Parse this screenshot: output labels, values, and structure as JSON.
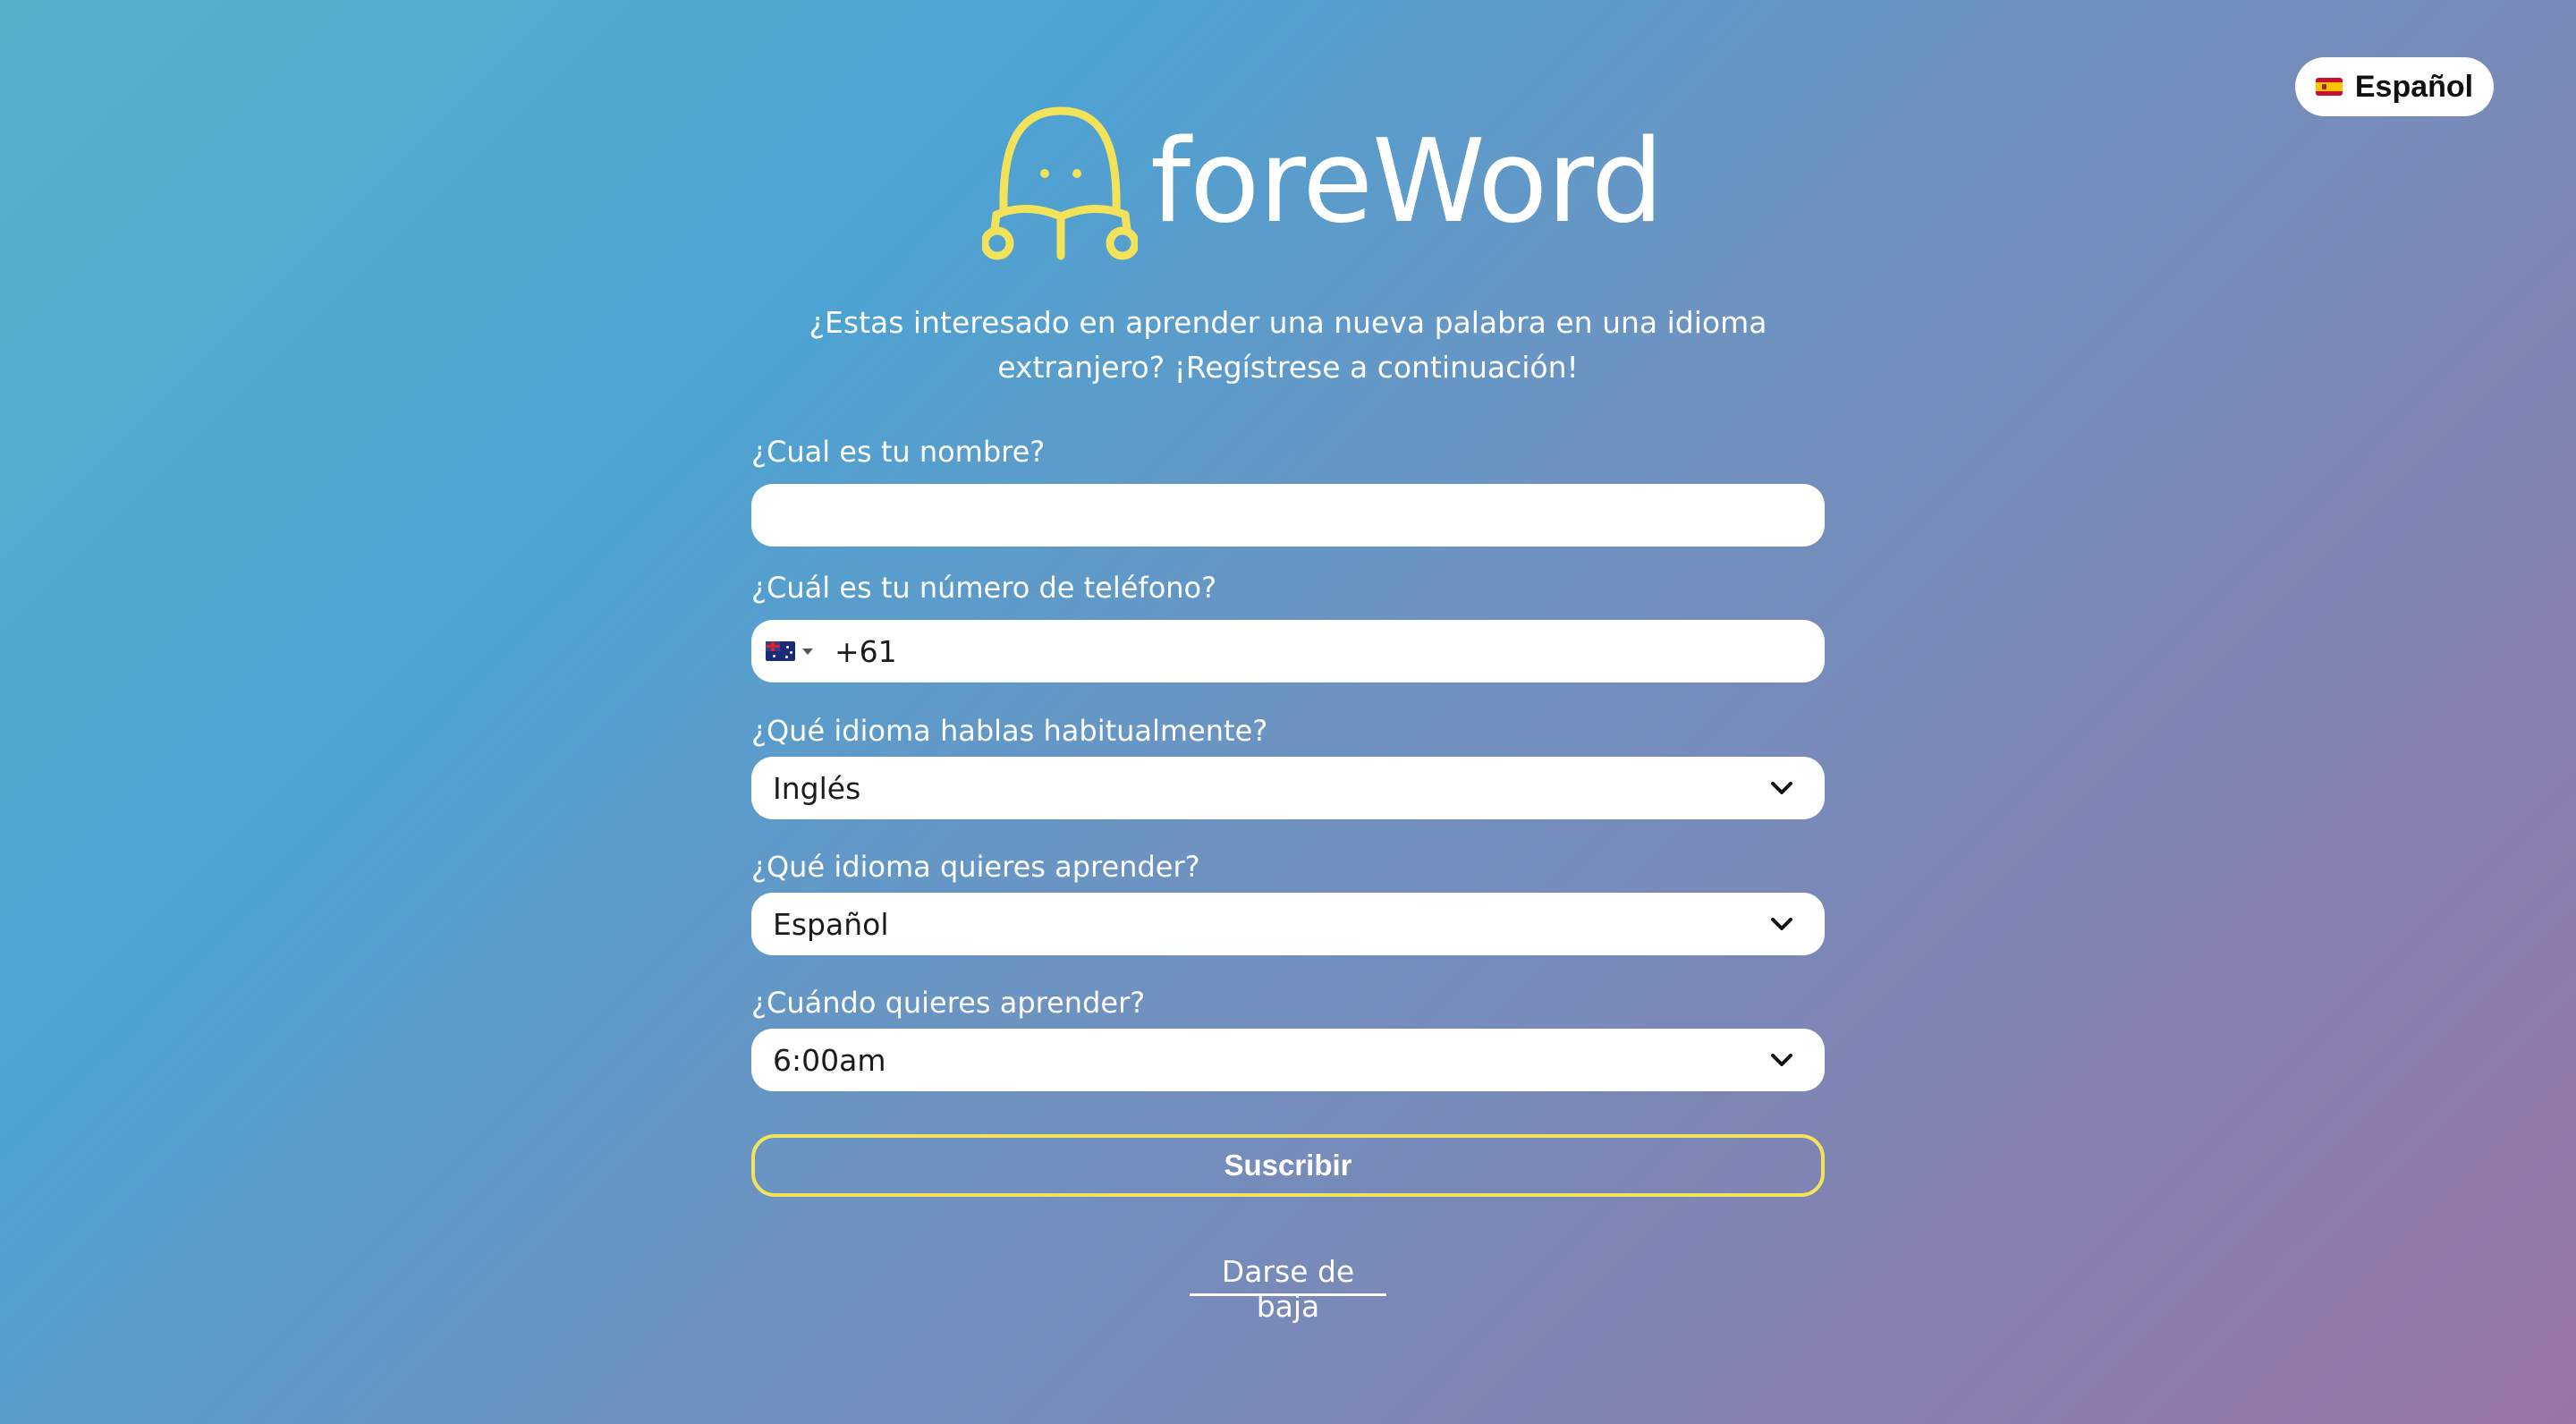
{
  "language_toggle": {
    "label": "Español",
    "flag_icon": "spain-flag-icon"
  },
  "header": {
    "logo_icon": "reading-person-logo-icon",
    "brand_name": "foreWord",
    "intro_line1": "¿Estas interesado en aprender una nueva palabra en una idioma",
    "intro_line2": "extranjero? ¡Regístrese a continuación!"
  },
  "form": {
    "name": {
      "label": "¿Cual es tu nombre?",
      "value": ""
    },
    "phone": {
      "label": "¿Cuál es tu número de teléfono?",
      "country_flag_icon": "australia-flag-icon",
      "country_code": "+61"
    },
    "native_language": {
      "label": "¿Qué idioma hablas habitualmente?",
      "selected": "Inglés"
    },
    "target_language": {
      "label": "¿Qué idioma quieres aprender?",
      "selected": "Español"
    },
    "learn_time": {
      "label": "¿Cuándo quieres aprender?",
      "selected": "6:00am"
    },
    "submit_label": "Suscribir"
  },
  "unsubscribe_label": "Darse de baja",
  "colors": {
    "accent_yellow": "#f3e35a",
    "gradient_start": "#4da3d3",
    "gradient_end": "#9775a6"
  }
}
